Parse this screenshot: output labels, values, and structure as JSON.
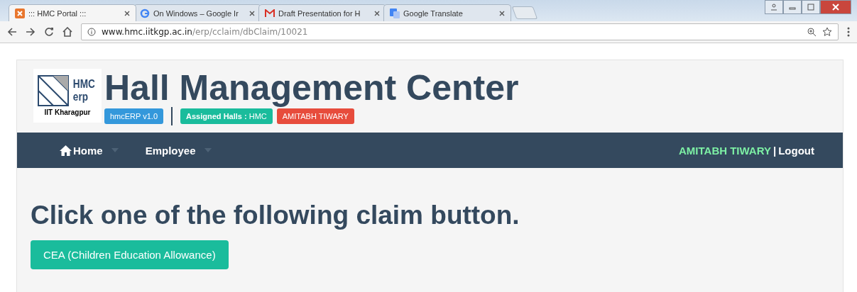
{
  "browser": {
    "tabs": [
      {
        "title": "::: HMC Portal :::",
        "selected": true
      },
      {
        "title": "On Windows – Google Ir",
        "selected": false
      },
      {
        "title": "Draft Presentation for H",
        "selected": false
      },
      {
        "title": "Google Translate",
        "selected": false
      }
    ],
    "url_host": "www.hmc.iitkgp.ac.in",
    "url_path": "/erp/cclaim/dbClaim/10021"
  },
  "header": {
    "logo_top": "HMC",
    "logo_bottom": "erp",
    "logo_caption": "IIT Kharagpur",
    "title": "Hall Management Center",
    "badges": [
      {
        "text": "hmcERP v1.0",
        "color": "#3498db"
      },
      {
        "text": "**Assigned Halls :** HMC",
        "color": "#1abc9c"
      },
      {
        "text": "AMITABH TIWARY",
        "color": "#e74c3c"
      }
    ]
  },
  "navbar": {
    "items": [
      {
        "label": "Home"
      },
      {
        "label": "Employee"
      }
    ],
    "user": "AMITABH TIWARY",
    "separator": "|",
    "logout": "Logout"
  },
  "content": {
    "heading": "Click one of the following claim button.",
    "buttons": [
      "CEA (Children Education Allowance)"
    ]
  }
}
